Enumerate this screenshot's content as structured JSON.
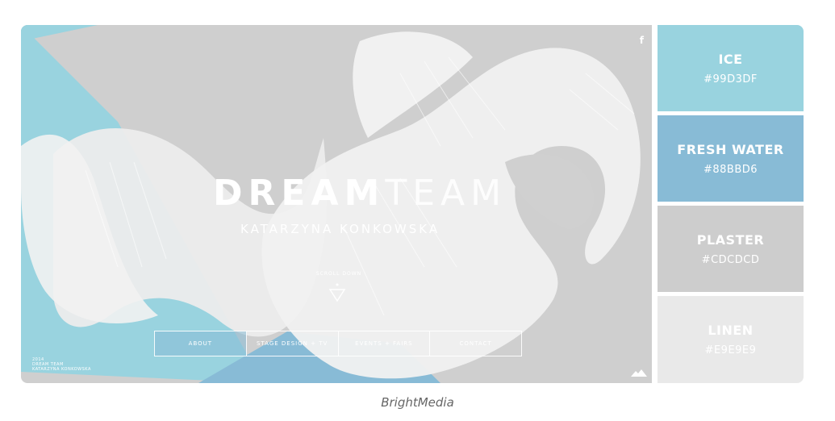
{
  "hero": {
    "facebook_glyph": "f",
    "title_bold": "DREAM",
    "title_light": "TEAM",
    "subtitle": "KATARZYNA KONKOWSKA",
    "scroll_label": "SCROLL DOWN",
    "nav": [
      "ABOUT",
      "STAGE DESIGN + TV",
      "EVENTS + FAIRS",
      "CONTACT"
    ],
    "credits": [
      "2014",
      "DREAM TEAM",
      "KATARZYNA KONKOWSKA"
    ]
  },
  "palette": [
    {
      "name": "ICE",
      "hex": "#99D3DF",
      "color": "#99D3DF"
    },
    {
      "name": "FRESH WATER",
      "hex": "#88BBD6",
      "color": "#88BBD6"
    },
    {
      "name": "PLASTER",
      "hex": "#CDCDCD",
      "color": "#CDCDCD"
    },
    {
      "name": "LINEN",
      "hex": "#E9E9E9",
      "color": "#E9E9E9"
    }
  ],
  "caption": "BrightMedia"
}
